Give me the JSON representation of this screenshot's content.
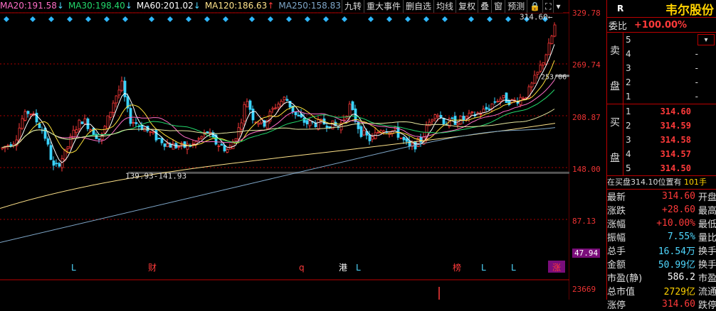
{
  "ma": [
    {
      "label": "MA20:",
      "value": "191.58",
      "arrow": "↓",
      "color": "#ff6ec7",
      "arrow_color": "#4fd8ff"
    },
    {
      "label": "MA30:",
      "value": "198.40",
      "arrow": "↓",
      "color": "#23d96c",
      "arrow_color": "#4fd8ff"
    },
    {
      "label": "MA60:",
      "value": "201.02",
      "arrow": "↓",
      "color": "#ffffff",
      "arrow_color": "#4fd8ff"
    },
    {
      "label": "MA120:",
      "value": "186.63",
      "arrow": "↑",
      "color": "#ffe38a",
      "arrow_color": "#ff3a3a"
    },
    {
      "label": "MA250:",
      "value": "158.83",
      "arrow": "↑",
      "color": "#7fa7c9",
      "arrow_color": "#ff3a3a"
    }
  ],
  "toolbar": [
    "九转",
    "重大事件",
    "删自选",
    "均线",
    "复权",
    "叠",
    "窗",
    "预测",
    "🔒",
    "⛶",
    "▾"
  ],
  "price_axis": [
    "329.78",
    "269.74",
    "208.87",
    "148.00",
    "87.13",
    "47.94",
    "23669"
  ],
  "annotations": {
    "high": "314.60",
    "low": "139.93-141.93",
    "date": "253/06"
  },
  "events": [
    {
      "label": "L",
      "color": "#4fd8ff"
    },
    {
      "label": "财",
      "color": "#ff3a3a"
    },
    {
      "label": "q",
      "color": "#ff3a3a"
    },
    {
      "label": "港",
      "color": "#ffffff"
    },
    {
      "label": "L",
      "color": "#4fd8ff"
    },
    {
      "label": "榜",
      "color": "#ff3a3a"
    },
    {
      "label": "L",
      "color": "#4fd8ff"
    },
    {
      "label": "L",
      "color": "#4fd8ff"
    },
    {
      "label": "涨",
      "color": "#ff3a3a"
    }
  ],
  "panel": {
    "code": "R",
    "name": "韦尔股份",
    "weibi_label": "委比",
    "weibi_value": "+100.00%",
    "sell_label": "卖盘",
    "buy_label": "买盘",
    "sell": [
      {
        "level": "5",
        "price": "",
        "vol": "-"
      },
      {
        "level": "4",
        "price": "",
        "vol": "-"
      },
      {
        "level": "3",
        "price": "",
        "vol": "-"
      },
      {
        "level": "2",
        "price": "",
        "vol": "-"
      },
      {
        "level": "1",
        "price": "",
        "vol": "-"
      }
    ],
    "buy": [
      {
        "level": "1",
        "price": "314.60"
      },
      {
        "level": "2",
        "price": "314.59"
      },
      {
        "level": "3",
        "price": "314.58"
      },
      {
        "level": "4",
        "price": "314.57"
      },
      {
        "level": "5",
        "price": "314.50"
      }
    ],
    "pending_text": "在买盘314.10位置有",
    "pending_num": "101手",
    "stats": [
      {
        "label": "最新",
        "value": "314.60",
        "cls": "red",
        "label2": "开盘"
      },
      {
        "label": "涨跌",
        "value": "+28.60",
        "cls": "red",
        "label2": "最高"
      },
      {
        "label": "涨幅",
        "value": "+10.00%",
        "cls": "red",
        "label2": "最低"
      },
      {
        "label": "振幅",
        "value": "7.55%",
        "cls": "cyan",
        "label2": "量比"
      },
      {
        "label": "总手",
        "value": "16.54万",
        "cls": "cyan",
        "label2": "换手"
      },
      {
        "label": "金额",
        "value": "50.99亿",
        "cls": "cyan",
        "label2": "换手"
      },
      {
        "label": "市盈(静)",
        "value": "586.2",
        "cls": "white",
        "label2": "市盈"
      },
      {
        "label": "总市值",
        "value": "2729亿",
        "cls": "yellow",
        "label2": "流通"
      },
      {
        "label": "涨停",
        "value": "314.60",
        "cls": "red",
        "label2": "跌停"
      }
    ]
  }
}
